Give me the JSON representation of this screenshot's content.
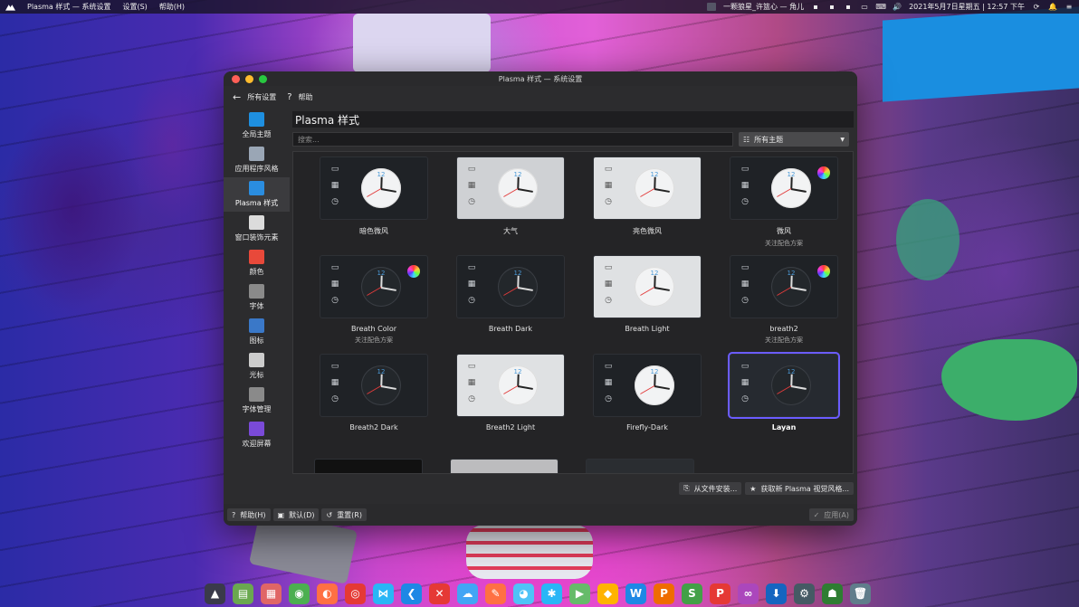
{
  "menubar": {
    "app_name": "Plasma 样式 — 系统设置",
    "menu_settings": "设置(S)",
    "menu_help": "帮助(H)",
    "now_playing": "一颗狼星_许篮心 — 角儿",
    "datetime": "2021年5月7日星期五 | 12:57 下午"
  },
  "window": {
    "title": "Plasma 样式 — 系统设置",
    "toolbar": {
      "back_label": "所有设置",
      "help_label": "帮助"
    },
    "sidebar": [
      {
        "label": "全局主题",
        "icon": "global-theme-icon",
        "color": "#1e8fe0"
      },
      {
        "label": "应用程序风格",
        "icon": "app-style-icon",
        "color": "#9aa6b5"
      },
      {
        "label": "Plasma 样式",
        "icon": "plasma-style-icon",
        "color": "#2a8de0",
        "active": true
      },
      {
        "label": "窗口装饰元素",
        "icon": "window-decoration-icon",
        "color": "#dcdcdc"
      },
      {
        "label": "颜色",
        "icon": "colors-icon",
        "color": "#e8493a"
      },
      {
        "label": "字体",
        "icon": "fonts-icon",
        "color": "#8a8a8a"
      },
      {
        "label": "图标",
        "icon": "icons-icon",
        "color": "#3a78c8"
      },
      {
        "label": "光标",
        "icon": "cursor-icon",
        "color": "#cccccc"
      },
      {
        "label": "字体管理",
        "icon": "font-management-icon",
        "color": "#8a8a8a"
      },
      {
        "label": "欢迎屏幕",
        "icon": "splash-screen-icon",
        "color": "#7a4ad8"
      }
    ],
    "page_title": "Plasma 样式",
    "search_placeholder": "搜索...",
    "filter_label": "所有主题",
    "themes": [
      {
        "name": "暗色微风",
        "subtitle": "",
        "style": "dark",
        "wheel": false
      },
      {
        "name": "大气",
        "subtitle": "",
        "style": "mid",
        "wheel": false
      },
      {
        "name": "亮色微风",
        "subtitle": "",
        "style": "light",
        "wheel": false
      },
      {
        "name": "微风",
        "subtitle": "关注配色方案",
        "style": "dark",
        "wheel": true
      },
      {
        "name": "Breath Color",
        "subtitle": "关注配色方案",
        "style": "darkc",
        "wheel": true
      },
      {
        "name": "Breath Dark",
        "subtitle": "",
        "style": "darkc",
        "wheel": false
      },
      {
        "name": "Breath Light",
        "subtitle": "",
        "style": "lightc",
        "wheel": false
      },
      {
        "name": "breath2",
        "subtitle": "关注配色方案",
        "style": "darkc",
        "wheel": true
      },
      {
        "name": "Breath2 Dark",
        "subtitle": "",
        "style": "darkc",
        "wheel": false
      },
      {
        "name": "Breath2 Light",
        "subtitle": "",
        "style": "lightc",
        "wheel": false
      },
      {
        "name": "Firefly-Dark",
        "subtitle": "",
        "style": "dark",
        "wheel": false
      },
      {
        "name": "Layan",
        "subtitle": "",
        "style": "layan",
        "wheel": false,
        "selected": true
      }
    ],
    "install_from_file": "从文件安装...",
    "get_new": "获取新 Plasma 视觉风格...",
    "footer": {
      "help": "帮助(H)",
      "defaults": "默认(D)",
      "reset": "重置(R)",
      "apply": "应用(A)"
    }
  },
  "dock": [
    {
      "icon": "plasma-launcher-icon",
      "color": "#3a3a4a",
      "glyph": "▲"
    },
    {
      "icon": "file-manager-icon",
      "color": "#6aa84f",
      "glyph": "▤"
    },
    {
      "icon": "app-grid-icon",
      "color": "#e06666",
      "glyph": "▦"
    },
    {
      "icon": "chrome-icon",
      "color": "#4caf50",
      "glyph": "◉"
    },
    {
      "icon": "firefox-icon",
      "color": "#ff7043",
      "glyph": "◐"
    },
    {
      "icon": "weibo-icon",
      "color": "#e53935",
      "glyph": "◎"
    },
    {
      "icon": "connect-icon",
      "color": "#29b6f6",
      "glyph": "⋈"
    },
    {
      "icon": "vscode-icon",
      "color": "#1e88e5",
      "glyph": "❮"
    },
    {
      "icon": "xmind-icon",
      "color": "#e53935",
      "glyph": "✕"
    },
    {
      "icon": "chat-icon",
      "color": "#42a5f5",
      "glyph": "☁"
    },
    {
      "icon": "pen-icon",
      "color": "#ff7043",
      "glyph": "✎"
    },
    {
      "icon": "qq-icon",
      "color": "#4fc3f7",
      "glyph": "◕"
    },
    {
      "icon": "star-icon",
      "color": "#29b6f6",
      "glyph": "✱"
    },
    {
      "icon": "player-icon",
      "color": "#66bb6a",
      "glyph": "▶"
    },
    {
      "icon": "wallet-icon",
      "color": "#ffb300",
      "glyph": "◆"
    },
    {
      "icon": "writer-icon",
      "color": "#1e88e5",
      "glyph": "W"
    },
    {
      "icon": "presentation-icon",
      "color": "#ef6c00",
      "glyph": "P"
    },
    {
      "icon": "spreadsheet-icon",
      "color": "#43a047",
      "glyph": "S"
    },
    {
      "icon": "pdf-icon",
      "color": "#e53935",
      "glyph": "P"
    },
    {
      "icon": "cloud-icon",
      "color": "#ab47bc",
      "glyph": "∞"
    },
    {
      "icon": "store-icon",
      "color": "#1565c0",
      "glyph": "⬇"
    },
    {
      "icon": "settings-icon",
      "color": "#455a64",
      "glyph": "⚙"
    },
    {
      "icon": "ghost-icon",
      "color": "#2e7d32",
      "glyph": "☗"
    },
    {
      "icon": "trash-icon",
      "color": "#607d8b",
      "glyph": "🗑"
    }
  ]
}
